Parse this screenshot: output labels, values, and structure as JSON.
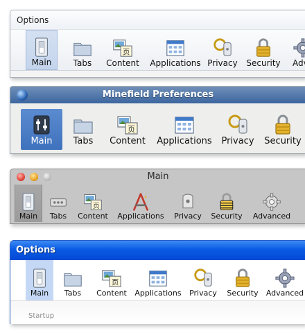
{
  "panels": [
    {
      "style": "windows-vista",
      "title": "Options",
      "tabs": [
        {
          "label": "Main",
          "icon": "switch-icon",
          "selected": true
        },
        {
          "label": "Tabs",
          "icon": "tabs-icon"
        },
        {
          "label": "Content",
          "icon": "content-icon"
        },
        {
          "label": "Applications",
          "icon": "applications-icon"
        },
        {
          "label": "Privacy",
          "icon": "privacy-icon"
        },
        {
          "label": "Security",
          "icon": "security-lock-icon"
        },
        {
          "label": "Adva",
          "icon": "advanced-gear-icon"
        }
      ]
    },
    {
      "style": "linux-gnome",
      "title": "Minefield Preferences",
      "tabs": [
        {
          "label": "Main",
          "icon": "switch-icon",
          "selected": true
        },
        {
          "label": "Tabs",
          "icon": "tabs-icon"
        },
        {
          "label": "Content",
          "icon": "content-icon"
        },
        {
          "label": "Applications",
          "icon": "applications-icon"
        },
        {
          "label": "Privacy",
          "icon": "privacy-icon"
        },
        {
          "label": "Security",
          "icon": "security-lock-icon"
        }
      ]
    },
    {
      "style": "mac-os-x",
      "title": "Main",
      "tabs": [
        {
          "label": "Main",
          "icon": "switch-icon",
          "selected": true
        },
        {
          "label": "Tabs",
          "icon": "tabs-icon"
        },
        {
          "label": "Content",
          "icon": "content-icon"
        },
        {
          "label": "Applications",
          "icon": "applications-icon"
        },
        {
          "label": "Privacy",
          "icon": "privacy-icon"
        },
        {
          "label": "Security",
          "icon": "security-lock-icon"
        },
        {
          "label": "Advanced",
          "icon": "advanced-gear-icon"
        }
      ]
    },
    {
      "style": "windows-xp",
      "title": "Options",
      "tabs": [
        {
          "label": "Main",
          "icon": "switch-icon",
          "selected": true
        },
        {
          "label": "Tabs",
          "icon": "tabs-icon"
        },
        {
          "label": "Content",
          "icon": "content-icon"
        },
        {
          "label": "Applications",
          "icon": "applications-icon"
        },
        {
          "label": "Privacy",
          "icon": "privacy-icon"
        },
        {
          "label": "Security",
          "icon": "security-lock-icon"
        },
        {
          "label": "Advanced",
          "icon": "advanced-gear-icon"
        }
      ],
      "section_label": "Startup"
    }
  ],
  "colors": {
    "vista_selection": "#c3d4ec",
    "gnome_titlebar": "#3d66a0",
    "gnome_selection": "#3f72bd",
    "mac_background": "#c6c6c6",
    "xp_titlebar": "#0a5be4",
    "xp_selection": "#c4d8f6"
  }
}
